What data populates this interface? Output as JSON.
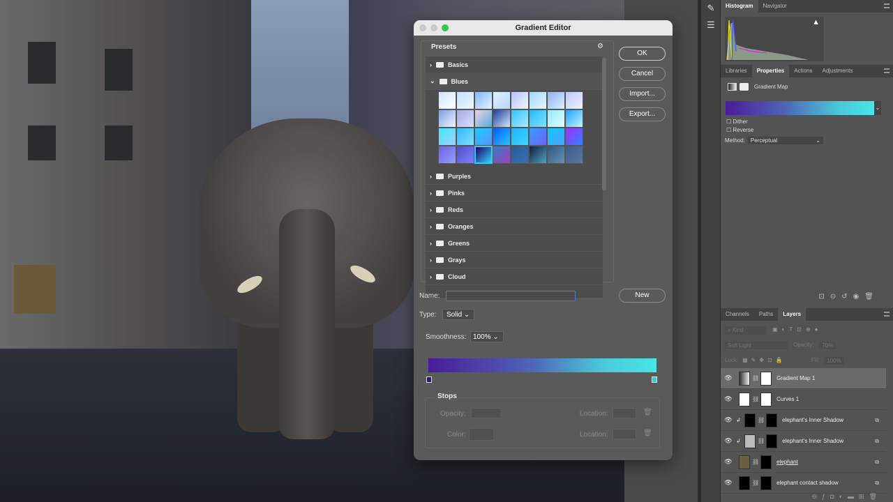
{
  "dialog": {
    "title": "Gradient Editor",
    "presets_label": "Presets",
    "folders": [
      "Basics",
      "Blues",
      "Purples",
      "Pinks",
      "Reds",
      "Oranges",
      "Greens",
      "Grays",
      "Cloud"
    ],
    "swatches": [
      [
        "#cfe6ff",
        "#ffffff"
      ],
      [
        "#bfe0ff",
        "#f0f8ff"
      ],
      [
        "#7fb6ff",
        "#e6f5ff"
      ],
      [
        "#dff0ff",
        "#b8d6ff"
      ],
      [
        "#b0c4ff",
        "#f2f7ff"
      ],
      [
        "#a0d8ff",
        "#e8f6ff"
      ],
      [
        "#8ab4f0",
        "#dceeff"
      ],
      [
        "#bcc8ff",
        "#eef2ff"
      ],
      [
        "#7f9fe0",
        "#eef5ff"
      ],
      [
        "#a8a6e0",
        "#d8e2ff"
      ],
      [
        "#f0d0e8",
        "#50b0d8"
      ],
      [
        "#1e3c9a",
        "#d0e6ff"
      ],
      [
        "#38c0ff",
        "#a0f0ff"
      ],
      [
        "#22b8f8",
        "#7fe8ff"
      ],
      [
        "#8fe8ff",
        "#e0ffff"
      ],
      [
        "#20a0ff",
        "#c0f8ff"
      ],
      [
        "#40e8ff",
        "#a0d0ff"
      ],
      [
        "#30b8ff",
        "#80e0ff"
      ],
      [
        "#10d0ff",
        "#6090ff"
      ],
      [
        "#0060ff",
        "#30c0ff"
      ],
      [
        "#20b0ff",
        "#40d8ff"
      ],
      [
        "#30a0ff",
        "#7060ff"
      ],
      [
        "#10c8ff",
        "#50a0ff"
      ],
      [
        "#a030ff",
        "#3080ff"
      ],
      [
        "#7060e0",
        "#90a0ff"
      ],
      [
        "#5050c0",
        "#8080ff"
      ],
      [
        "#200060",
        "#30d0ff"
      ],
      [
        "#3080c0",
        "#a040c0"
      ],
      [
        "#2a5a9a",
        "#3a70b0"
      ],
      [
        "#102040",
        "#50a0c0"
      ],
      [
        "#2a5a80",
        "#6a90b0"
      ],
      [
        "#3a5a8a",
        "#5a7aa0"
      ]
    ],
    "buttons": {
      "ok": "OK",
      "cancel": "Cancel",
      "import": "Import...",
      "export": "Export...",
      "new": "New"
    },
    "name_label": "Name:",
    "name_value": "",
    "type_label": "Type:",
    "type_value": "Solid",
    "smoothness_label": "Smoothness:",
    "smoothness_value": "100%",
    "gradient": {
      "start": "#4a1c9a",
      "end": "#46e6e6"
    },
    "stops": {
      "title": "Stops",
      "opacity_label": "Opacity:",
      "color_label": "Color:",
      "location_label": "Location:"
    }
  },
  "toolbar": {
    "tools": [
      "brush-settings-icon",
      "adjust-icon"
    ]
  },
  "histogram_panel": {
    "tabs": [
      "Histogram",
      "Navigator"
    ],
    "active": 0
  },
  "properties_panel": {
    "tabs": [
      "Libraries",
      "Properties",
      "Actions",
      "Adjustments"
    ],
    "active": 1,
    "type": "Gradient Map",
    "dither": "Dither",
    "reverse": "Reverse",
    "method_label": "Method:",
    "method_value": "Perceptual"
  },
  "layers_panel": {
    "tabs": [
      "Channels",
      "Paths",
      "Layers"
    ],
    "active": 2,
    "kind": "Kind",
    "blend": "Soft Light",
    "opacity_label": "Opacity:",
    "opacity": "70%",
    "lock_label": "Lock:",
    "fill_label": "Fill:",
    "fill": "100%",
    "layers": [
      "Gradient Map 1",
      "Curves 1",
      "elephant's Inner Shadow",
      "elephant's Inner Shadow",
      "elephant",
      "elephant contact shadow"
    ]
  }
}
